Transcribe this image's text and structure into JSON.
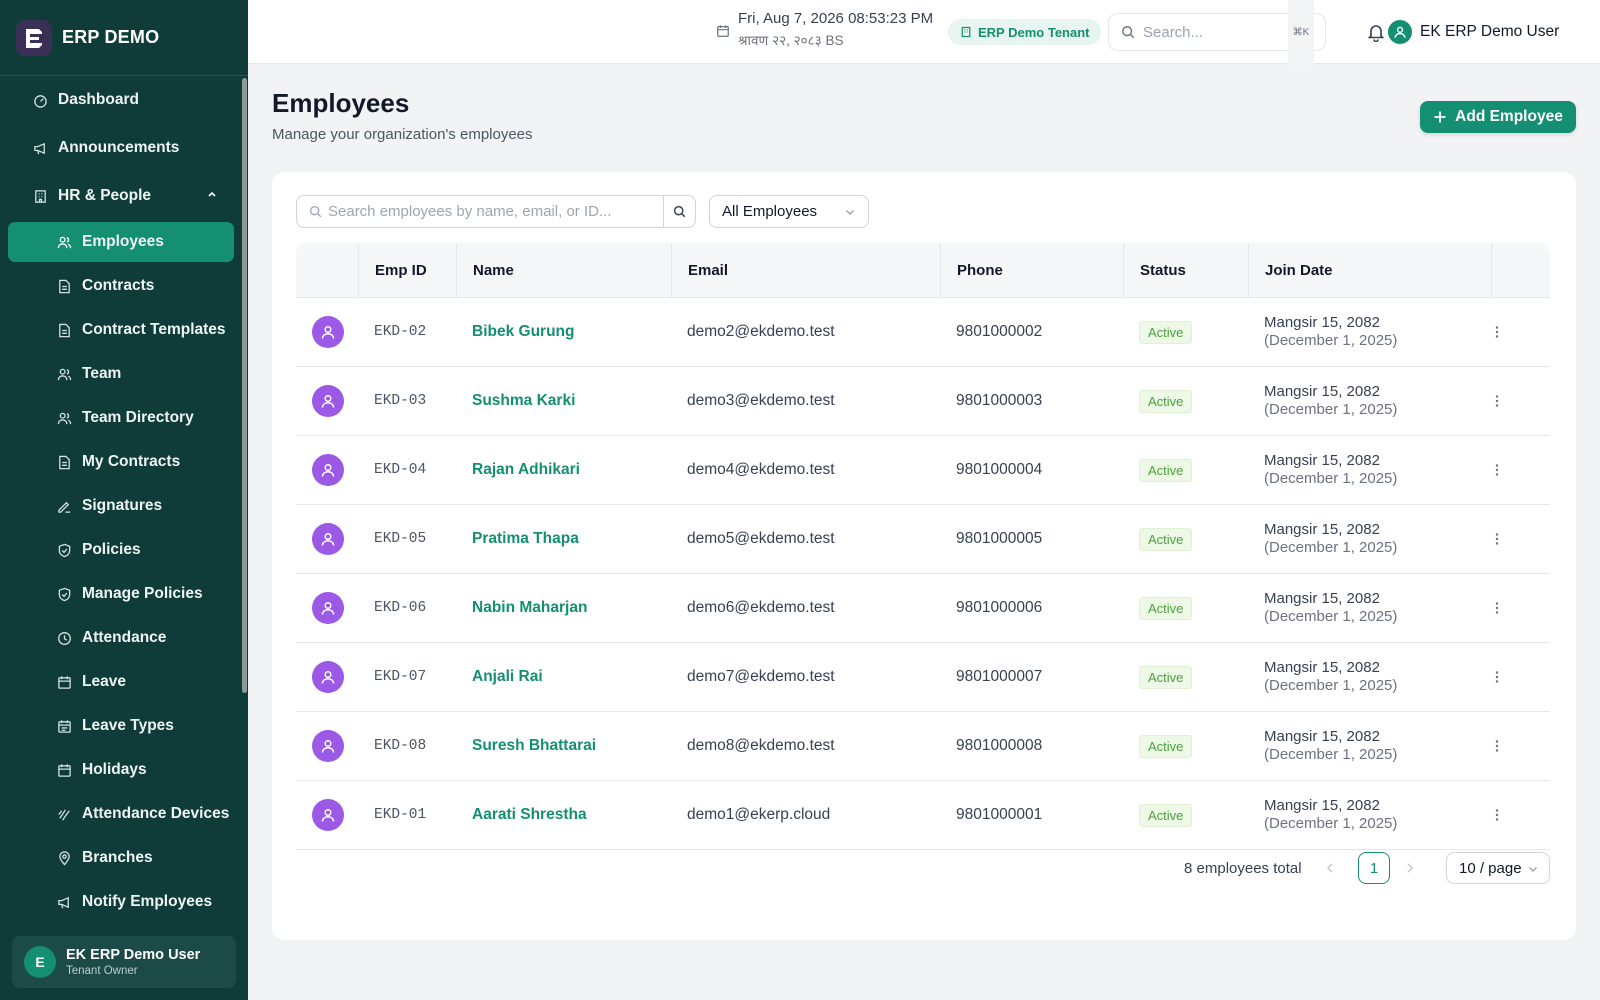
{
  "brand": {
    "name": "ERP DEMO"
  },
  "sidebar": {
    "items": [
      {
        "label": "Dashboard",
        "icon": "dashboard-icon",
        "level": "top"
      },
      {
        "label": "Announcements",
        "icon": "megaphone-icon",
        "level": "top"
      },
      {
        "label": "HR & People",
        "icon": "building-icon",
        "level": "top",
        "expanded": true
      },
      {
        "label": "Employees",
        "icon": "users-icon",
        "level": "sub",
        "active": true
      },
      {
        "label": "Contracts",
        "icon": "file-icon",
        "level": "sub"
      },
      {
        "label": "Contract Templates",
        "icon": "file-icon",
        "level": "sub"
      },
      {
        "label": "Team",
        "icon": "users-icon",
        "level": "sub"
      },
      {
        "label": "Team Directory",
        "icon": "users-icon",
        "level": "sub"
      },
      {
        "label": "My Contracts",
        "icon": "file-icon",
        "level": "sub"
      },
      {
        "label": "Signatures",
        "icon": "signature-icon",
        "level": "sub"
      },
      {
        "label": "Policies",
        "icon": "shield-icon",
        "level": "sub"
      },
      {
        "label": "Manage Policies",
        "icon": "shield-icon",
        "level": "sub"
      },
      {
        "label": "Attendance",
        "icon": "clock-icon",
        "level": "sub"
      },
      {
        "label": "Leave",
        "icon": "calendar-icon",
        "level": "sub"
      },
      {
        "label": "Leave Types",
        "icon": "calendar-icon",
        "level": "sub"
      },
      {
        "label": "Holidays",
        "icon": "calendar-icon",
        "level": "sub"
      },
      {
        "label": "Attendance Devices",
        "icon": "fingerprint-icon",
        "level": "sub"
      },
      {
        "label": "Branches",
        "icon": "map-pin-icon",
        "level": "sub"
      },
      {
        "label": "Notify Employees",
        "icon": "megaphone-icon",
        "level": "sub"
      }
    ],
    "user": {
      "initial": "E",
      "name": "EK ERP Demo User",
      "role": "Tenant Owner"
    }
  },
  "header": {
    "datetime": "Fri, Aug 7, 2026 08:53:23 PM",
    "bs_date": "श्रावण २२, २०८३ BS",
    "tenant": "ERP Demo Tenant",
    "search_placeholder": "Search...",
    "shortcut": "⌘K",
    "user_name": "EK ERP Demo User"
  },
  "page": {
    "title": "Employees",
    "subtitle": "Manage your organization's employees",
    "add_button": "Add Employee"
  },
  "filters": {
    "search_placeholder": "Search employees by name, email, or ID...",
    "status_filter": "All Employees"
  },
  "table": {
    "columns": [
      "Emp ID",
      "Name",
      "Email",
      "Phone",
      "Status",
      "Join Date"
    ],
    "rows": [
      {
        "emp_id": "EKD-02",
        "name": "Bibek Gurung",
        "email": "demo2@ekdemo.test",
        "phone": "9801000002",
        "status": "Active",
        "join_bs": "Mangsir 15, 2082",
        "join_ad": "(December 1, 2025)"
      },
      {
        "emp_id": "EKD-03",
        "name": "Sushma Karki",
        "email": "demo3@ekdemo.test",
        "phone": "9801000003",
        "status": "Active",
        "join_bs": "Mangsir 15, 2082",
        "join_ad": "(December 1, 2025)"
      },
      {
        "emp_id": "EKD-04",
        "name": "Rajan Adhikari",
        "email": "demo4@ekdemo.test",
        "phone": "9801000004",
        "status": "Active",
        "join_bs": "Mangsir 15, 2082",
        "join_ad": "(December 1, 2025)"
      },
      {
        "emp_id": "EKD-05",
        "name": "Pratima Thapa",
        "email": "demo5@ekdemo.test",
        "phone": "9801000005",
        "status": "Active",
        "join_bs": "Mangsir 15, 2082",
        "join_ad": "(December 1, 2025)"
      },
      {
        "emp_id": "EKD-06",
        "name": "Nabin Maharjan",
        "email": "demo6@ekdemo.test",
        "phone": "9801000006",
        "status": "Active",
        "join_bs": "Mangsir 15, 2082",
        "join_ad": "(December 1, 2025)"
      },
      {
        "emp_id": "EKD-07",
        "name": "Anjali Rai",
        "email": "demo7@ekdemo.test",
        "phone": "9801000007",
        "status": "Active",
        "join_bs": "Mangsir 15, 2082",
        "join_ad": "(December 1, 2025)"
      },
      {
        "emp_id": "EKD-08",
        "name": "Suresh Bhattarai",
        "email": "demo8@ekdemo.test",
        "phone": "9801000008",
        "status": "Active",
        "join_bs": "Mangsir 15, 2082",
        "join_ad": "(December 1, 2025)"
      },
      {
        "emp_id": "EKD-01",
        "name": "Aarati Shrestha",
        "email": "demo1@ekerp.cloud",
        "phone": "9801000001",
        "status": "Active",
        "join_bs": "Mangsir 15, 2082",
        "join_ad": "(December 1, 2025)"
      }
    ]
  },
  "pagination": {
    "total_text": "8 employees total",
    "current_page": "1",
    "page_size": "10 / page"
  },
  "colors": {
    "sidebar_bg": "#0f3b38",
    "accent": "#148f72",
    "avatar": "#9b59e6",
    "status_active": "#49a23a"
  }
}
